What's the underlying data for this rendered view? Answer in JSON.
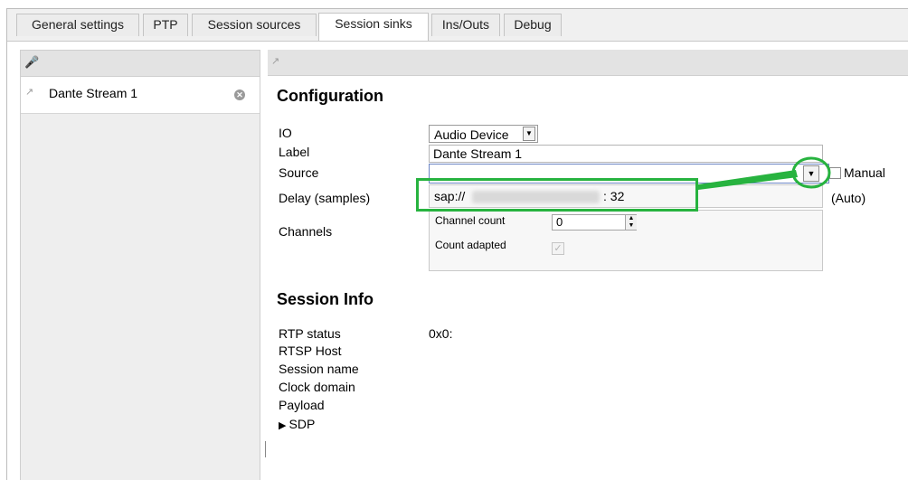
{
  "tabs": [
    {
      "label": "General settings",
      "active": false
    },
    {
      "label": "PTP",
      "active": false
    },
    {
      "label": "Session sources",
      "active": false
    },
    {
      "label": "Session sinks",
      "active": true
    },
    {
      "label": "Ins/Outs",
      "active": false
    },
    {
      "label": "Debug",
      "active": false
    }
  ],
  "sidebar": {
    "toolbar_icon": "microphone-add-icon",
    "items": [
      {
        "icon": "microphone-icon",
        "label": "Dante Stream 1",
        "close_icon": "close-circle-icon"
      }
    ]
  },
  "main": {
    "toolbar_icon": "microphone-icon",
    "configuration": {
      "title": "Configuration",
      "io_label": "IO",
      "io_value": "Audio Device",
      "label_label": "Label",
      "label_value": "Dante Stream 1",
      "source_label": "Source",
      "source_value": "",
      "manual_label": "Manual",
      "manual_checked": false,
      "delay_label": "Delay (samples)",
      "delay_prefix": "sap://",
      "delay_suffix": ": 32",
      "delay_mode": "(Auto)",
      "channels_label": "Channels",
      "channel_count_label": "Channel count",
      "channel_count_value": "0",
      "count_adapted_label": "Count adapted",
      "count_adapted_checked": true
    },
    "session_info": {
      "title": "Session Info",
      "rows": [
        {
          "label": "RTP status",
          "value": "0x0:"
        },
        {
          "label": "RTSP Host",
          "value": ""
        },
        {
          "label": "Session name",
          "value": ""
        },
        {
          "label": "Clock domain",
          "value": ""
        },
        {
          "label": "Payload",
          "value": ""
        }
      ],
      "sdp_label": "SDP",
      "sdp_icon": "triangle-right-icon"
    }
  },
  "colors": {
    "highlight": "#27b33f",
    "source_border": "#6c86c4"
  }
}
